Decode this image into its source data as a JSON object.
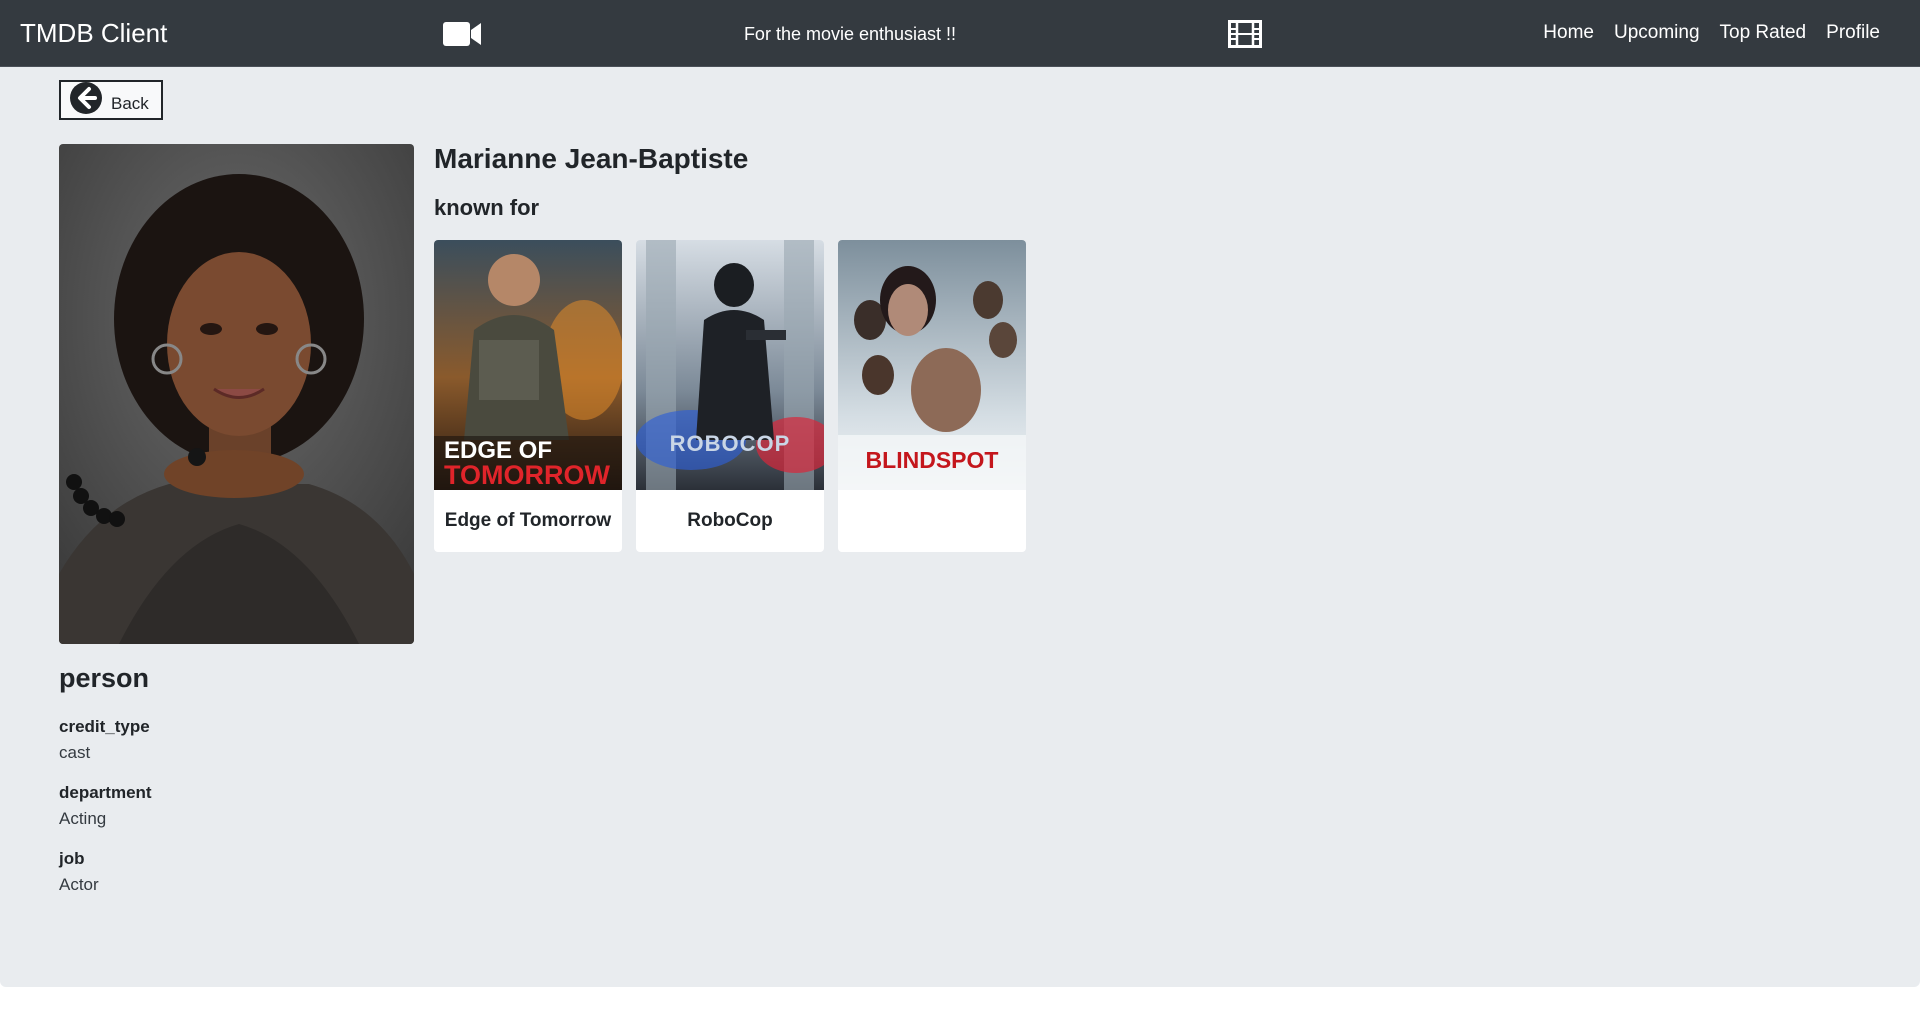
{
  "navbar": {
    "brand": "TMDB Client",
    "tagline": "For the movie enthusiast !!",
    "icons": {
      "left": "video-camera-icon",
      "right": "film-strip-icon"
    },
    "links": [
      "Home",
      "Upcoming",
      "Top Rated",
      "Profile"
    ]
  },
  "back_button": {
    "label": "Back",
    "icon": "arrow-left-circle-icon"
  },
  "person": {
    "name": "Marianne Jean-Baptiste",
    "known_for_heading": "known for",
    "section_title": "person",
    "fields": [
      {
        "key": "credit_type",
        "value": "cast"
      },
      {
        "key": "department",
        "value": "Acting"
      },
      {
        "key": "job",
        "value": "Actor"
      }
    ]
  },
  "known_for": [
    {
      "title": "Edge of Tomorrow",
      "poster_text_1": "EDGE OF",
      "poster_text_2": "TOMORROW"
    },
    {
      "title": "RoboCop",
      "poster_text_1": "ROBOCOP",
      "poster_text_2": ""
    },
    {
      "title": "",
      "poster_text_1": "BLINDSPOT",
      "poster_text_2": ""
    }
  ],
  "colors": {
    "navbar_bg": "#343a40",
    "page_bg": "#e9ecef",
    "blindspot_red": "#c4161c",
    "edge_red": "#e0242a"
  }
}
